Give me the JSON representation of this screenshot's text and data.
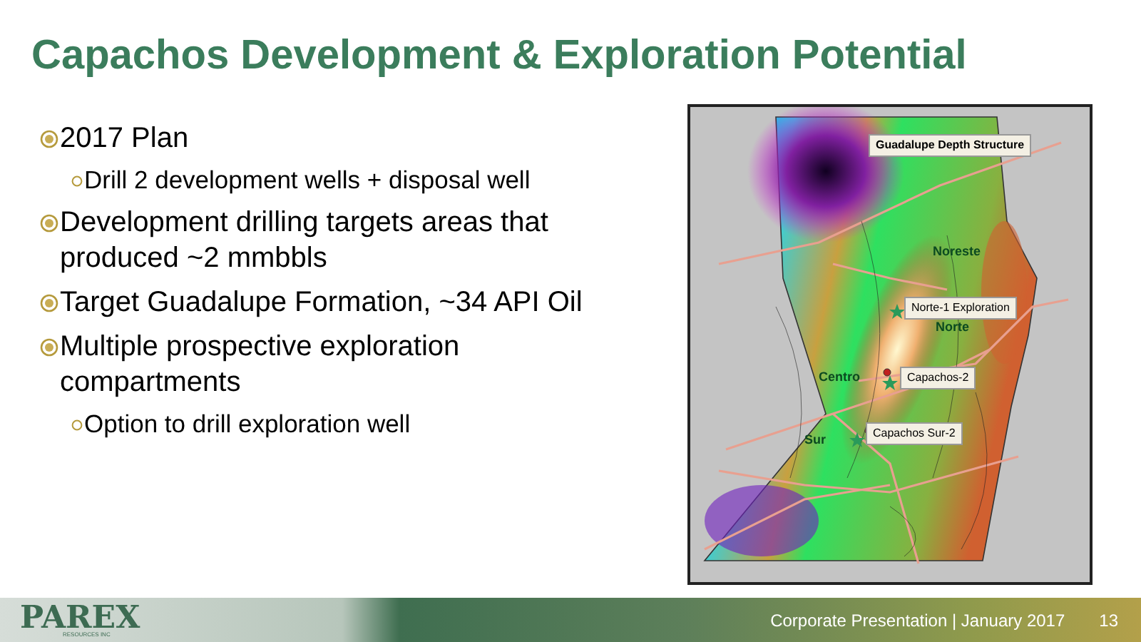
{
  "title": "Capachos Development & Exploration Potential",
  "bullets": [
    {
      "text": "2017 Plan",
      "children": [
        {
          "text": "Drill 2 development wells + disposal well"
        }
      ]
    },
    {
      "text": "Development drilling targets areas that produced ~2 mmbbls"
    },
    {
      "text": "Target Guadalupe Formation, ~34 API Oil"
    },
    {
      "text": "Multiple prospective exploration compartments",
      "children": [
        {
          "text": "Option to drill exploration well"
        }
      ]
    }
  ],
  "map": {
    "title": "Guadalupe Depth Structure",
    "labels": [
      {
        "text": "Noreste",
        "kind": "area"
      },
      {
        "text": "Norte-1 Exploration",
        "kind": "well"
      },
      {
        "text": "Norte",
        "kind": "area"
      },
      {
        "text": "Capachos-2",
        "kind": "well"
      },
      {
        "text": "Centro",
        "kind": "area"
      },
      {
        "text": "Capachos Sur-2",
        "kind": "well"
      },
      {
        "text": "Sur",
        "kind": "area"
      }
    ]
  },
  "footer": {
    "logo": "PAREX",
    "logo_sub": "RESOURCES INC",
    "presentation": "Corporate Presentation | January 2017",
    "page": "13"
  }
}
